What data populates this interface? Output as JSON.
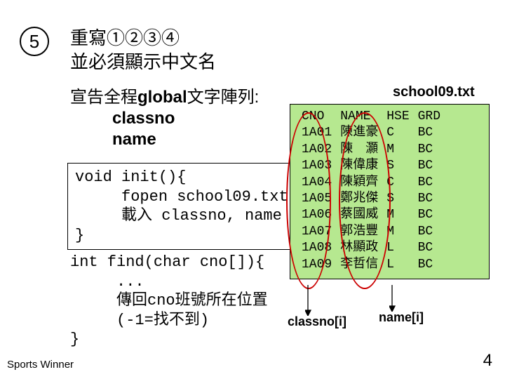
{
  "step_number": "5",
  "title_line1": "重寫①②③④",
  "title_line2": "並必須顯示中文名",
  "decl": {
    "line1_prefix": "宣告全程",
    "line1_bold": "global",
    "line1_suffix": "文字陣列:",
    "line2": "classno",
    "line3": "name"
  },
  "code_init": "void init(){\n     fopen school09.txt\n     載入 classno, name\n}",
  "code_find": "int find(char cno[]){\n     ...\n     傳回cno班號所在位置\n     (-1=找不到)\n}",
  "file_name": "school09.txt",
  "table_header": [
    "CNO",
    "NAME",
    "HSE",
    "GRD"
  ],
  "table_rows": [
    [
      "1A01",
      "陳進豪",
      "C",
      "BC"
    ],
    [
      "1A02",
      "陳　灝",
      "M",
      "BC"
    ],
    [
      "1A03",
      "陳偉康",
      "S",
      "BC"
    ],
    [
      "1A04",
      "陳穎齊",
      "C",
      "BC"
    ],
    [
      "1A05",
      "鄭兆傑",
      "S",
      "BC"
    ],
    [
      "1A06",
      "蔡國威",
      "M",
      "BC"
    ],
    [
      "1A07",
      "郭浩豐",
      "M",
      "BC"
    ],
    [
      "1A08",
      "林顯政",
      "L",
      "BC"
    ],
    [
      "1A09",
      "李哲信",
      "L",
      "BC"
    ]
  ],
  "label_classno": "classno[i]",
  "label_name": "name[i]",
  "footer_left": "Sports Winner",
  "page_number": "4",
  "chart_data": {
    "type": "table",
    "title": "school09.txt",
    "columns": [
      "CNO",
      "NAME",
      "HSE",
      "GRD"
    ],
    "rows": [
      [
        "1A01",
        "陳進豪",
        "C",
        "BC"
      ],
      [
        "1A02",
        "陳　灝",
        "M",
        "BC"
      ],
      [
        "1A03",
        "陳偉康",
        "S",
        "BC"
      ],
      [
        "1A04",
        "陳穎齊",
        "C",
        "BC"
      ],
      [
        "1A05",
        "鄭兆傑",
        "S",
        "BC"
      ],
      [
        "1A06",
        "蔡國威",
        "M",
        "BC"
      ],
      [
        "1A07",
        "郭浩豐",
        "M",
        "BC"
      ],
      [
        "1A08",
        "林顯政",
        "L",
        "BC"
      ],
      [
        "1A09",
        "李哲信",
        "L",
        "BC"
      ]
    ]
  }
}
